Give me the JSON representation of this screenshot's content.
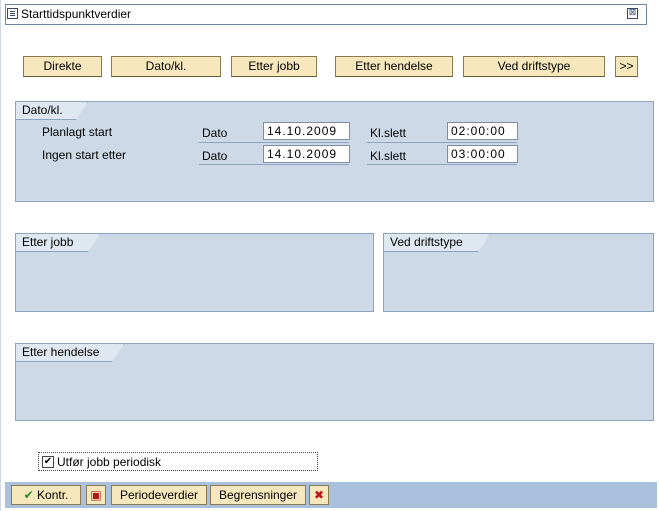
{
  "window": {
    "title": "Starttidspunktverdier",
    "close_glyph": "⊠"
  },
  "toolbar": {
    "buttons": [
      {
        "label": "Direkte"
      },
      {
        "label": "Dato/kl."
      },
      {
        "label": "Etter jobb"
      },
      {
        "label": "Etter hendelse"
      },
      {
        "label": "Ved driftstype"
      },
      {
        "label": ">>"
      }
    ]
  },
  "date_panel": {
    "tab": "Dato/kl.",
    "rows": [
      {
        "label": "Planlagt start",
        "date_label": "Dato",
        "date_value": "14.10.2009",
        "time_label": "Kl.slett",
        "time_value": "02:00:00"
      },
      {
        "label": "Ingen start etter",
        "date_label": "Dato",
        "date_value": "14.10.2009",
        "time_label": "Kl.slett",
        "time_value": "03:00:00"
      }
    ]
  },
  "after_job_panel": {
    "tab": "Etter jobb"
  },
  "operation_mode_panel": {
    "tab": "Ved driftstype"
  },
  "after_event_panel": {
    "tab": "Etter hendelse"
  },
  "periodic": {
    "label": "Utfør jobb periodisk",
    "checked": true,
    "check_glyph": "✔"
  },
  "footer": {
    "check_label": "Kontr.",
    "check_glyph": "✔",
    "save_glyph": "▣",
    "period_values_label": "Periodeverdier",
    "restrictions_label": "Begrensninger",
    "cancel_glyph": "✖"
  },
  "colors": {
    "panel": "#cdd9e6",
    "button": "#f7e7bc",
    "footer": "#a9c1dd",
    "cancel": "#c0141c",
    "check": "#2f8a2f"
  }
}
